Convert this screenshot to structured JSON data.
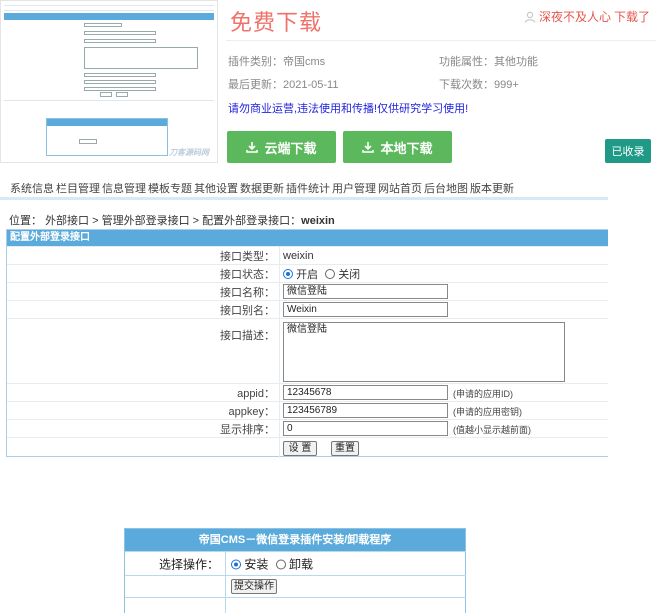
{
  "product": {
    "title": "免费下载",
    "user_link": "深夜不及人心",
    "download_action": "下载了",
    "category_label": "插件类别：",
    "category_value": "帝国cms",
    "attr_label": "功能属性：",
    "attr_value": "其他功能",
    "updated_label": "最后更新：",
    "updated_value": "2021-05-11",
    "downloads_label": "下载次数：",
    "downloads_value": "999+",
    "warning": "请勿商业运营,违法使用和传播!仅供研究学习使用!",
    "cloud_btn": "云端下载",
    "local_btn": "本地下载",
    "fav_btn": "已收录",
    "thumb_watermark": "刀客源码网"
  },
  "colors": {
    "accent_red": "#f0716a",
    "download_green": "#5cb85c",
    "fav_teal": "#1e9a86",
    "panel_blue": "#5aaadb",
    "warning_blue": "#2222dd"
  },
  "admin": {
    "nav": [
      "系统信息",
      "栏目管理",
      "信息管理",
      "模板专题",
      "其他设置",
      "数据更新",
      "插件统计",
      "用户管理",
      "网站首页",
      "后台地图",
      "版本更新"
    ],
    "breadcrumb": {
      "prefix": "位置：",
      "c1": "外部接口",
      "sep": " > ",
      "c2": "管理外部登录接口",
      "c3": "配置外部登录接口：",
      "current": "weixin"
    },
    "panel_title": "配置外部登录接口",
    "fields": {
      "type_label": "接口类型：",
      "type_value": "weixin",
      "status_label": "接口状态：",
      "status_on": "开启",
      "status_off": "关闭",
      "name_label": "接口名称：",
      "name_value": "微信登陆",
      "alias_label": "接口别名：",
      "alias_value": "Weixin",
      "desc_label": "接口描述：",
      "desc_value": "微信登陆",
      "appid_label": "appid：",
      "appid_value": "12345678",
      "appid_hint": "(申请的应用ID)",
      "appkey_label": "appkey：",
      "appkey_value": "123456789",
      "appkey_hint": "(申请的应用密钥)",
      "order_label": "显示排序：",
      "order_value": "0",
      "order_hint": "(值越小显示越前面)"
    },
    "submit_btn": "设 置",
    "reset_btn": "重置"
  },
  "install": {
    "title": "帝国CMS－微信登录插件安装/卸载程序",
    "op_label": "选择操作：",
    "op_install": "安装",
    "op_uninstall": "卸载",
    "submit_btn": "提交操作"
  }
}
